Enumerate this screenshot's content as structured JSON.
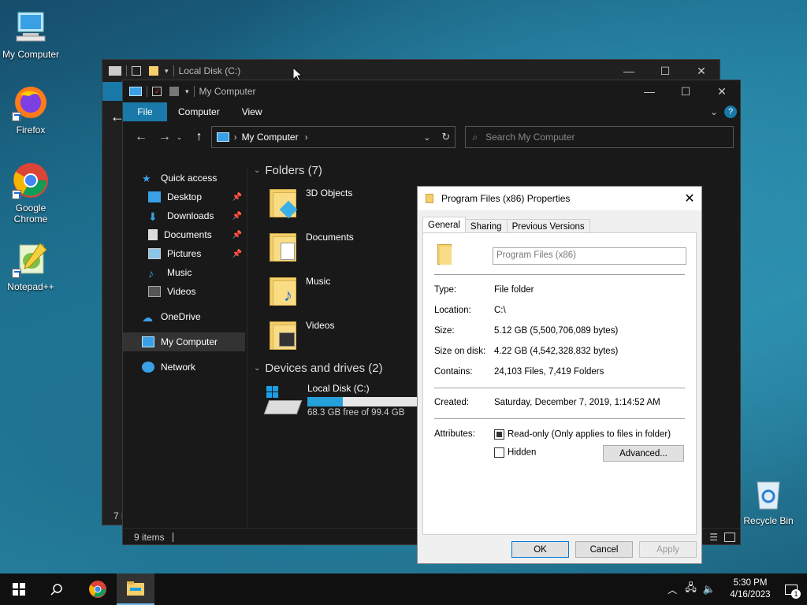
{
  "desktop": {
    "icons": [
      {
        "label": "My Computer"
      },
      {
        "label": "Firefox"
      },
      {
        "label": "Google Chrome"
      },
      {
        "label": "Notepad++"
      },
      {
        "label": "Recycle Bin"
      }
    ]
  },
  "back_window": {
    "title": "Local Disk (C:)",
    "status_fragment": "7 i"
  },
  "explorer": {
    "title": "My Computer",
    "tabs": [
      "File",
      "Computer",
      "View"
    ],
    "address": {
      "location": "My Computer"
    },
    "search_placeholder": "Search My Computer",
    "nav": {
      "quick_access": "Quick access",
      "pinned": [
        {
          "label": "Desktop"
        },
        {
          "label": "Downloads"
        },
        {
          "label": "Documents"
        },
        {
          "label": "Pictures"
        }
      ],
      "others": [
        {
          "label": "Music"
        },
        {
          "label": "Videos"
        }
      ],
      "onedrive": "OneDrive",
      "this_pc": "My Computer",
      "network": "Network"
    },
    "folders_header": "Folders (7)",
    "folders": [
      {
        "label": "3D Objects"
      },
      {
        "label": "Documents"
      },
      {
        "label": "Music"
      },
      {
        "label": "Videos"
      }
    ],
    "drives_header": "Devices and drives (2)",
    "drive": {
      "label": "Local Disk (C:)",
      "free": "68.3 GB free of 99.4 GB",
      "used_fraction": 0.31
    },
    "status": "9 items"
  },
  "dialog": {
    "title": "Program Files (x86) Properties",
    "tabs": [
      "General",
      "Sharing",
      "Previous Versions"
    ],
    "name_value": "Program Files (x86)",
    "type_k": "Type:",
    "type_v": "File folder",
    "location_k": "Location:",
    "location_v": "C:\\",
    "size_k": "Size:",
    "size_v": "5.12 GB (5,500,706,089 bytes)",
    "sod_k": "Size on disk:",
    "sod_v": "4.22 GB (4,542,328,832 bytes)",
    "contains_k": "Contains:",
    "contains_v": "24,103 Files, 7,419 Folders",
    "created_k": "Created:",
    "created_v": "Saturday, December 7, 2019, 1:14:52 AM",
    "attributes_k": "Attributes:",
    "readonly_label": "Read-only (Only applies to files in folder)",
    "hidden_label": "Hidden",
    "advanced_label": "Advanced...",
    "ok_label": "OK",
    "cancel_label": "Cancel",
    "apply_label": "Apply"
  },
  "taskbar": {
    "time": "5:30 PM",
    "date": "4/16/2023",
    "notification_count": "1"
  }
}
